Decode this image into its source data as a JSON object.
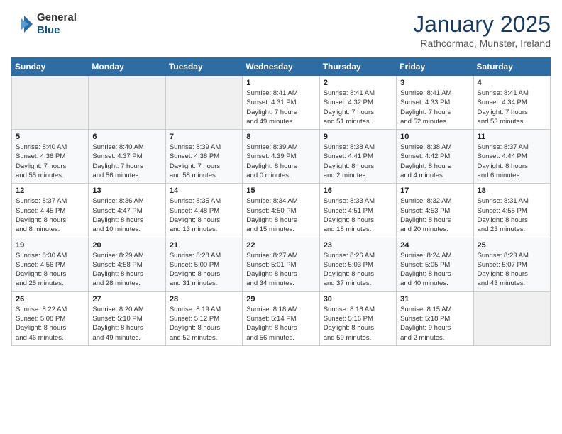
{
  "header": {
    "logo_general": "General",
    "logo_blue": "Blue",
    "month": "January 2025",
    "location": "Rathcormac, Munster, Ireland"
  },
  "days_of_week": [
    "Sunday",
    "Monday",
    "Tuesday",
    "Wednesday",
    "Thursday",
    "Friday",
    "Saturday"
  ],
  "weeks": [
    [
      {
        "day": "",
        "info": ""
      },
      {
        "day": "",
        "info": ""
      },
      {
        "day": "",
        "info": ""
      },
      {
        "day": "1",
        "info": "Sunrise: 8:41 AM\nSunset: 4:31 PM\nDaylight: 7 hours\nand 49 minutes."
      },
      {
        "day": "2",
        "info": "Sunrise: 8:41 AM\nSunset: 4:32 PM\nDaylight: 7 hours\nand 51 minutes."
      },
      {
        "day": "3",
        "info": "Sunrise: 8:41 AM\nSunset: 4:33 PM\nDaylight: 7 hours\nand 52 minutes."
      },
      {
        "day": "4",
        "info": "Sunrise: 8:41 AM\nSunset: 4:34 PM\nDaylight: 7 hours\nand 53 minutes."
      }
    ],
    [
      {
        "day": "5",
        "info": "Sunrise: 8:40 AM\nSunset: 4:36 PM\nDaylight: 7 hours\nand 55 minutes."
      },
      {
        "day": "6",
        "info": "Sunrise: 8:40 AM\nSunset: 4:37 PM\nDaylight: 7 hours\nand 56 minutes."
      },
      {
        "day": "7",
        "info": "Sunrise: 8:39 AM\nSunset: 4:38 PM\nDaylight: 7 hours\nand 58 minutes."
      },
      {
        "day": "8",
        "info": "Sunrise: 8:39 AM\nSunset: 4:39 PM\nDaylight: 8 hours\nand 0 minutes."
      },
      {
        "day": "9",
        "info": "Sunrise: 8:38 AM\nSunset: 4:41 PM\nDaylight: 8 hours\nand 2 minutes."
      },
      {
        "day": "10",
        "info": "Sunrise: 8:38 AM\nSunset: 4:42 PM\nDaylight: 8 hours\nand 4 minutes."
      },
      {
        "day": "11",
        "info": "Sunrise: 8:37 AM\nSunset: 4:44 PM\nDaylight: 8 hours\nand 6 minutes."
      }
    ],
    [
      {
        "day": "12",
        "info": "Sunrise: 8:37 AM\nSunset: 4:45 PM\nDaylight: 8 hours\nand 8 minutes."
      },
      {
        "day": "13",
        "info": "Sunrise: 8:36 AM\nSunset: 4:47 PM\nDaylight: 8 hours\nand 10 minutes."
      },
      {
        "day": "14",
        "info": "Sunrise: 8:35 AM\nSunset: 4:48 PM\nDaylight: 8 hours\nand 13 minutes."
      },
      {
        "day": "15",
        "info": "Sunrise: 8:34 AM\nSunset: 4:50 PM\nDaylight: 8 hours\nand 15 minutes."
      },
      {
        "day": "16",
        "info": "Sunrise: 8:33 AM\nSunset: 4:51 PM\nDaylight: 8 hours\nand 18 minutes."
      },
      {
        "day": "17",
        "info": "Sunrise: 8:32 AM\nSunset: 4:53 PM\nDaylight: 8 hours\nand 20 minutes."
      },
      {
        "day": "18",
        "info": "Sunrise: 8:31 AM\nSunset: 4:55 PM\nDaylight: 8 hours\nand 23 minutes."
      }
    ],
    [
      {
        "day": "19",
        "info": "Sunrise: 8:30 AM\nSunset: 4:56 PM\nDaylight: 8 hours\nand 25 minutes."
      },
      {
        "day": "20",
        "info": "Sunrise: 8:29 AM\nSunset: 4:58 PM\nDaylight: 8 hours\nand 28 minutes."
      },
      {
        "day": "21",
        "info": "Sunrise: 8:28 AM\nSunset: 5:00 PM\nDaylight: 8 hours\nand 31 minutes."
      },
      {
        "day": "22",
        "info": "Sunrise: 8:27 AM\nSunset: 5:01 PM\nDaylight: 8 hours\nand 34 minutes."
      },
      {
        "day": "23",
        "info": "Sunrise: 8:26 AM\nSunset: 5:03 PM\nDaylight: 8 hours\nand 37 minutes."
      },
      {
        "day": "24",
        "info": "Sunrise: 8:24 AM\nSunset: 5:05 PM\nDaylight: 8 hours\nand 40 minutes."
      },
      {
        "day": "25",
        "info": "Sunrise: 8:23 AM\nSunset: 5:07 PM\nDaylight: 8 hours\nand 43 minutes."
      }
    ],
    [
      {
        "day": "26",
        "info": "Sunrise: 8:22 AM\nSunset: 5:08 PM\nDaylight: 8 hours\nand 46 minutes."
      },
      {
        "day": "27",
        "info": "Sunrise: 8:20 AM\nSunset: 5:10 PM\nDaylight: 8 hours\nand 49 minutes."
      },
      {
        "day": "28",
        "info": "Sunrise: 8:19 AM\nSunset: 5:12 PM\nDaylight: 8 hours\nand 52 minutes."
      },
      {
        "day": "29",
        "info": "Sunrise: 8:18 AM\nSunset: 5:14 PM\nDaylight: 8 hours\nand 56 minutes."
      },
      {
        "day": "30",
        "info": "Sunrise: 8:16 AM\nSunset: 5:16 PM\nDaylight: 8 hours\nand 59 minutes."
      },
      {
        "day": "31",
        "info": "Sunrise: 8:15 AM\nSunset: 5:18 PM\nDaylight: 9 hours\nand 2 minutes."
      },
      {
        "day": "",
        "info": ""
      }
    ]
  ]
}
